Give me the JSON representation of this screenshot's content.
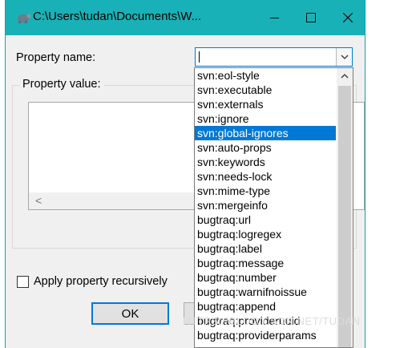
{
  "window": {
    "title": "C:\\Users\\tudan\\Documents\\W...",
    "icons": {
      "app": "tortoise-icon",
      "minimize": "minimize-icon",
      "maximize": "maximize-icon",
      "close": "close-icon"
    },
    "accent_color": "#19b1b8"
  },
  "property_name": {
    "label": "Property name:",
    "value": "",
    "dropdown_icon": "chevron-down-icon"
  },
  "property_value": {
    "label": "Property value:",
    "value": "",
    "scroll_left_glyph": "<"
  },
  "recursive": {
    "label": "Apply property recursively",
    "checked": false
  },
  "buttons": {
    "ok": "OK",
    "cancel": ""
  },
  "dropdown": {
    "selected_index": 4,
    "selection_color": "#0078d7",
    "items": [
      "svn:eol-style",
      "svn:executable",
      "svn:externals",
      "svn:ignore",
      "svn:global-ignores",
      "svn:auto-props",
      "svn:keywords",
      "svn:needs-lock",
      "svn:mime-type",
      "svn:mergeinfo",
      "bugtraq:url",
      "bugtraq:logregex",
      "bugtraq:label",
      "bugtraq:message",
      "bugtraq:number",
      "bugtraq:warnifnoissue",
      "bugtraq:append",
      "bugtraq:provideruuid",
      "bugtraq:providerparams"
    ]
  },
  "watermark": "HTTPS://BLOG.CSDN.NET/TUDAN"
}
